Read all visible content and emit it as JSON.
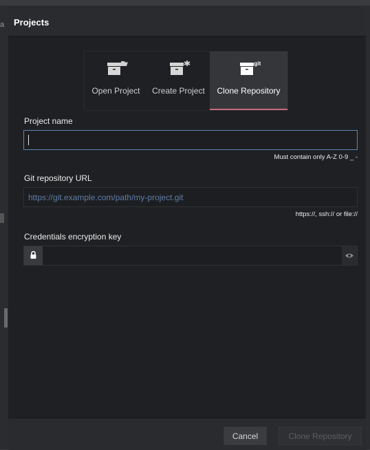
{
  "background": {
    "fragment": "a"
  },
  "dialog": {
    "title": "Projects"
  },
  "tabs": [
    {
      "label": "Open Project",
      "icon": "open-folder-box-icon",
      "active": false
    },
    {
      "label": "Create Project",
      "icon": "new-box-asterisk-icon",
      "active": false
    },
    {
      "label": "Clone Repository",
      "icon": "git-box-icon",
      "active": true,
      "icon_text": "git"
    }
  ],
  "form": {
    "project_name": {
      "label": "Project name",
      "value": "",
      "placeholder": "",
      "hint": "Must contain only A-Z 0-9 _ -"
    },
    "git_url": {
      "label": "Git repository URL",
      "value": "",
      "placeholder": "https://git.example.com/path/my-project.git",
      "hint": "https://, ssh:// or file://"
    },
    "credentials": {
      "label": "Credentials encryption key",
      "value": "",
      "placeholder": ""
    }
  },
  "footer": {
    "cancel_label": "Cancel",
    "clone_label": "Clone Repository"
  },
  "colors": {
    "dialog_bg": "#1f2023",
    "header_bg": "#2a2b2e",
    "active_tab_bg": "#35363a",
    "active_tab_accent": "#c8697a",
    "focus_border": "#5a86b6",
    "placeholder": "#5f7ea8"
  }
}
